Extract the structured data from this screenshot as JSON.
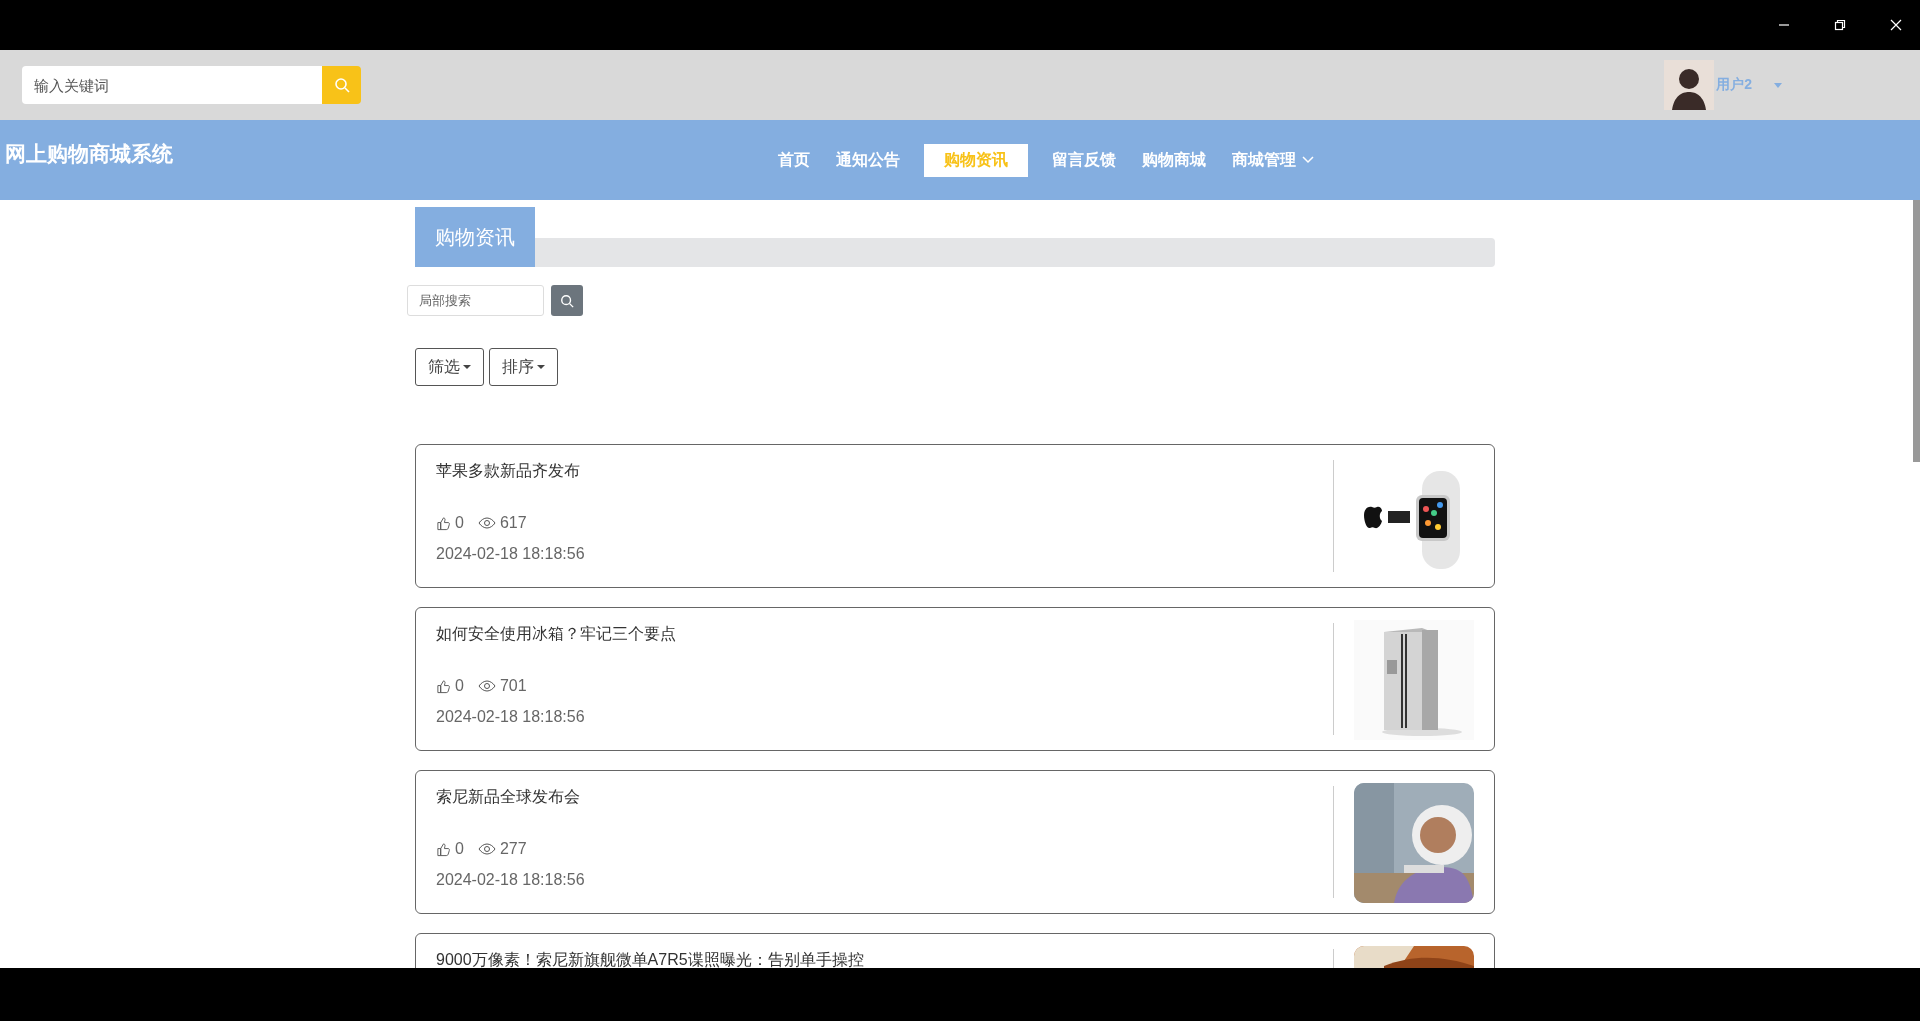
{
  "header": {
    "search": {
      "placeholder": "输入关键词"
    },
    "user": {
      "name": "用户2"
    }
  },
  "nav": {
    "brand": "网上购物商城系统",
    "items": [
      {
        "label": "首页",
        "selected": false,
        "dropdown": false
      },
      {
        "label": "通知公告",
        "selected": false,
        "dropdown": false
      },
      {
        "label": "购物资讯",
        "selected": true,
        "dropdown": false
      },
      {
        "label": "留言反馈",
        "selected": false,
        "dropdown": false
      },
      {
        "label": "购物商城",
        "selected": false,
        "dropdown": false
      },
      {
        "label": "商城管理",
        "selected": false,
        "dropdown": true
      }
    ]
  },
  "page": {
    "title": "购物资讯",
    "search": {
      "placeholder": "局部搜索"
    },
    "buttons": [
      "筛选",
      "排序"
    ]
  },
  "articles": [
    {
      "title": "苹果多款新品齐发布",
      "likes": "0",
      "views": "617",
      "date": "2024-02-18 18:18:56"
    },
    {
      "title": "如何安全使用冰箱？牢记三个要点",
      "likes": "0",
      "views": "701",
      "date": "2024-02-18 18:18:56"
    },
    {
      "title": "索尼新品全球发布会",
      "likes": "0",
      "views": "277",
      "date": "2024-02-18 18:18:56"
    },
    {
      "title": "9000万像素！索尼新旗舰微单A7R5谍照曝光：告别单手操控"
    }
  ]
}
